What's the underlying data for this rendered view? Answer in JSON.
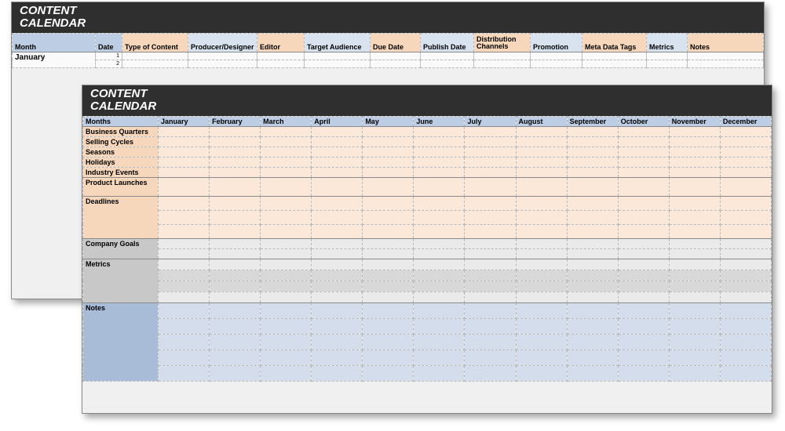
{
  "back": {
    "title_line1": "CONTENT",
    "title_line2": "CALENDAR",
    "columns": [
      "Month",
      "Date",
      "Type of Content",
      "Producer/Designer",
      "Editor",
      "Target Audience",
      "Due Date",
      "Publish Date",
      "Distribution Channels",
      "Promotion",
      "Meta Data Tags",
      "Metrics",
      "Notes"
    ],
    "first_month": "January",
    "row_numbers": [
      "1",
      "2"
    ]
  },
  "front": {
    "title_line1": "CONTENT",
    "title_line2": "CALENDAR",
    "months_label": "Months",
    "months": [
      "January",
      "February",
      "March",
      "April",
      "May",
      "June",
      "July",
      "August",
      "September",
      "October",
      "November",
      "December"
    ],
    "sections_orange": [
      "Business Quarters",
      "Selling Cycles",
      "Seasons",
      "Holidays",
      "Industry Events",
      "Product Launches",
      "Deadlines"
    ],
    "section_company": "Company Goals",
    "section_metrics": "Metrics",
    "section_notes": "Notes"
  }
}
